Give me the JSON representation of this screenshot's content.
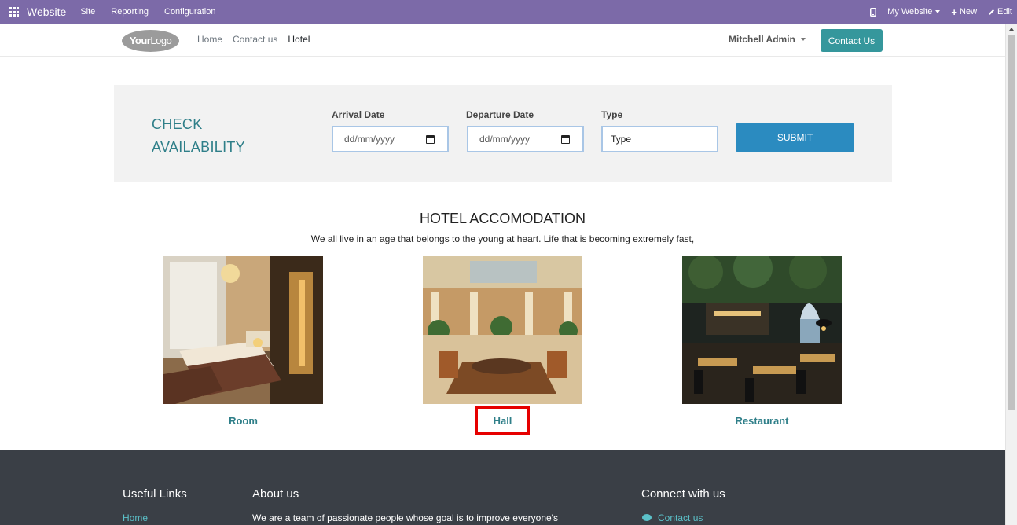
{
  "adminbar": {
    "brand": "Website",
    "menus": [
      "Site",
      "Reporting",
      "Configuration"
    ],
    "my_website": "My Website",
    "new": "New",
    "edit": "Edit"
  },
  "header": {
    "logo_text_bold": "Your",
    "logo_text": "Logo",
    "nav": [
      "Home",
      "Contact us",
      "Hotel"
    ],
    "active_nav": "Hotel",
    "user": "Mitchell Admin",
    "contact_button": "Contact Us"
  },
  "availability": {
    "title_line1": "CHECK",
    "title_line2": "AVAILABILITY",
    "arrival_label": "Arrival Date",
    "arrival_placeholder": "dd/mm/yyyy",
    "departure_label": "Departure Date",
    "departure_placeholder": "dd/mm/yyyy",
    "type_label": "Type",
    "type_placeholder": "Type",
    "submit": "SUBMIT"
  },
  "accommodation": {
    "title": "HOTEL ACCOMODATION",
    "subtitle": "We all live in an age that belongs to the young at heart. Life that is becoming extremely fast,",
    "cards": [
      {
        "label": "Room",
        "image": "hotel-room-photo"
      },
      {
        "label": "Hall",
        "image": "hotel-hall-photo"
      },
      {
        "label": "Restaurant",
        "image": "restaurant-photo"
      }
    ],
    "highlighted": "Hall"
  },
  "footer": {
    "useful_links_title": "Useful Links",
    "useful_link_1": "Home",
    "about_title": "About us",
    "about_text": "We are a team of passionate people whose goal is to improve everyone's",
    "connect_title": "Connect with us",
    "connect_link": "Contact us"
  },
  "colors": {
    "adminbar": "#7c6aa8",
    "accent_teal": "#35979c",
    "submit_blue": "#2b8bc0",
    "highlight_red": "#e60000",
    "footer_bg": "#3a3f46"
  }
}
